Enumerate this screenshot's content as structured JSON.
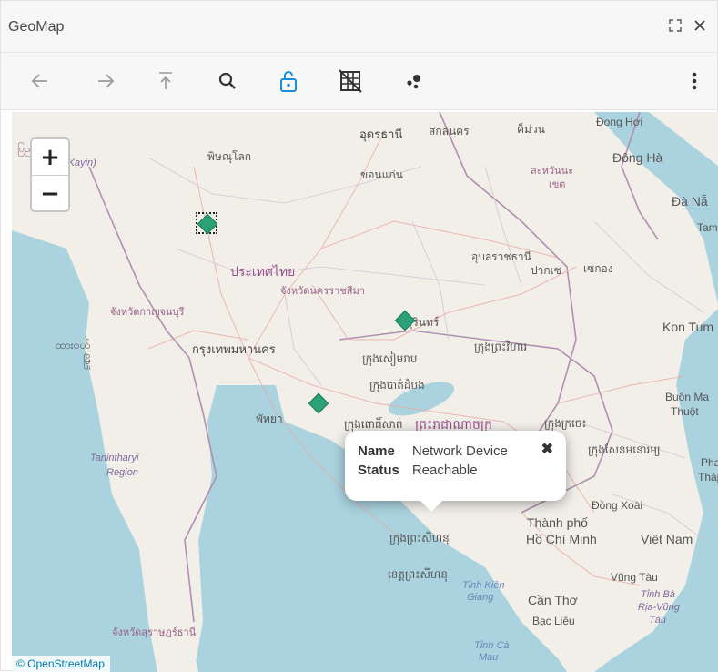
{
  "window": {
    "title": "GeoMap",
    "maximize_icon": "expand-icon",
    "close_icon": "close-icon"
  },
  "toolbar": {
    "tools": [
      {
        "name": "back-button",
        "icon": "arrow-left-icon",
        "glyph": "←",
        "color": "#9a9a9a"
      },
      {
        "name": "forward-button",
        "icon": "arrow-right-icon",
        "glyph": "→",
        "color": "#9a9a9a"
      },
      {
        "name": "top-button",
        "icon": "arrow-top-icon",
        "glyph": "⤒",
        "color": "#9a9a9a"
      },
      {
        "name": "search-button",
        "icon": "search-icon",
        "glyph": "",
        "color": "#333333"
      },
      {
        "name": "lock-button",
        "icon": "unlock-icon",
        "glyph": "",
        "color": "#1a8fd8"
      },
      {
        "name": "grid-toggle-button",
        "icon": "grid-off-icon",
        "glyph": "",
        "color": "#333333"
      },
      {
        "name": "cluster-button",
        "icon": "cluster-icon",
        "glyph": "",
        "color": "#333333"
      },
      {
        "name": "more-menu-button",
        "icon": "more-vertical-icon",
        "glyph": "⋮",
        "color": "#333333"
      }
    ]
  },
  "map": {
    "zoom_in": "+",
    "zoom_out": "−",
    "attribution": "© OpenStreetMap",
    "marker_color": "#2aa177",
    "water_color": "#aad3df",
    "land_color": "#f2efe9",
    "places": [
      {
        "text": "อุดรธานี"
      },
      {
        "text": "สกลนคร"
      },
      {
        "text": "ค็ม่วน"
      },
      {
        "text": "Đong Hơi"
      },
      {
        "text": "ပြည်ပြည်"
      },
      {
        "text": "(Kayin)"
      },
      {
        "text": "พิษณุโลก"
      },
      {
        "text": "ขอนแก่น"
      },
      {
        "text": "สะหวันนะ"
      },
      {
        "text": "เขต"
      },
      {
        "text": "Đông Hà"
      },
      {
        "text": "Đà Nẵ"
      },
      {
        "text": "Tam"
      },
      {
        "text": "ประเทศไทย"
      },
      {
        "text": "จังหวัดนครราชสีมา"
      },
      {
        "text": "อุบลราชธานี"
      },
      {
        "text": "ปากเซ"
      },
      {
        "text": "เซกอง"
      },
      {
        "text": "จังหวัดกาญจนบุรี"
      },
      {
        "text": "สุรินทร์"
      },
      {
        "text": "Kon Tum"
      },
      {
        "text": "ထားဝယ်"
      },
      {
        "text": "မြို"
      },
      {
        "text": "กรุงเทพมหานคร"
      },
      {
        "text": "ក្រុងសៀមរាប"
      },
      {
        "text": "ក្រុងព្រះវិហារ"
      },
      {
        "text": "ក្រុងបាត់ដំបង"
      },
      {
        "text": "พัทยา"
      },
      {
        "text": "ក្រុងពោធិ៍សាត់"
      },
      {
        "text": "ព្រះរាជាណាចក្រ"
      },
      {
        "text": "ក្រុងក្រចេះ"
      },
      {
        "text": "Buôn Ma"
      },
      {
        "text": "Thuột"
      },
      {
        "text": "Tanintharyi"
      },
      {
        "text": "Region"
      },
      {
        "text": "ក្រុងសែនមនោរម្យ"
      },
      {
        "text": "Phan R"
      },
      {
        "text": "Tháp C"
      },
      {
        "text": "Đồng Xoài"
      },
      {
        "text": "Thành phố"
      },
      {
        "text": "Hồ Chí Minh"
      },
      {
        "text": "Việt Nam"
      },
      {
        "text": "ក្រុងព្រះសីហនុ"
      },
      {
        "text": "ខេត្តព្រះសីហនុ"
      },
      {
        "text": "Tỉnh Kiên"
      },
      {
        "text": "Giang"
      },
      {
        "text": "Vũng Tàu"
      },
      {
        "text": "Cần Thơ"
      },
      {
        "text": "Tỉnh Bà"
      },
      {
        "text": "Rịa-Vũng"
      },
      {
        "text": "Tàu"
      },
      {
        "text": "Bạc Liêu"
      },
      {
        "text": "จังหวัดสุราษฎร์ธานี"
      },
      {
        "text": "Tỉnh Cà"
      },
      {
        "text": "Mau"
      }
    ],
    "popup": {
      "rows": [
        {
          "key": "Name",
          "value": "Network Device"
        },
        {
          "key": "Status",
          "value": "Reachable"
        }
      ],
      "close_glyph": "✖"
    }
  }
}
